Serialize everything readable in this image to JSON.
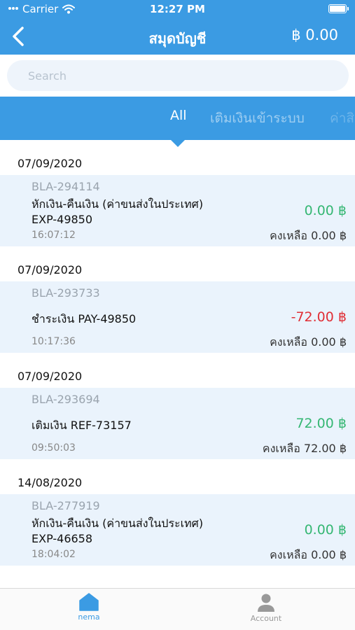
{
  "status_bar": {
    "carrier": "Carrier",
    "time": "12:27 PM"
  },
  "nav": {
    "title": "สมุดบัญชี",
    "balance": "฿ 0.00"
  },
  "search": {
    "placeholder": "Search"
  },
  "tabs": [
    {
      "label": "All"
    },
    {
      "label": "เติมเงินเข้าระบบ"
    },
    {
      "label": "ค่าสิ"
    }
  ],
  "entries": [
    {
      "date": "07/09/2020",
      "code": "BLA-294114",
      "desc_line1": "หักเงิน-คืนเงิน (ค่าขนส่งในประเทศ)",
      "desc_line2": "EXP-49850",
      "time": "16:07:12",
      "amount": "0.00 ฿",
      "remaining": "คงเหลือ 0.00 ฿"
    },
    {
      "date": "07/09/2020",
      "code": "BLA-293733",
      "desc_line1": "ชำระเงิน PAY-49850",
      "time": "10:17:36",
      "amount": "-72.00 ฿",
      "remaining": "คงเหลือ 0.00 ฿"
    },
    {
      "date": "07/09/2020",
      "code": "BLA-293694",
      "desc_line1": "เติมเงิน REF-73157",
      "time": "09:50:03",
      "amount": "72.00 ฿",
      "remaining": "คงเหลือ 72.00 ฿"
    },
    {
      "date": "14/08/2020",
      "code": "BLA-277919",
      "desc_line1": "หักเงิน-คืนเงิน (ค่าขนส่งในประเทศ)",
      "desc_line2": "EXP-46658",
      "time": "18:04:02",
      "amount": "0.00 ฿",
      "remaining": "คงเหลือ 0.00 ฿"
    }
  ],
  "tabbar": {
    "home_label": "nema",
    "account_label": "Account"
  },
  "colors": {
    "primary": "#3b9be3",
    "positive": "#35b773",
    "negative": "#e02f36",
    "entry_bg": "#eaf3fc"
  },
  "icons": {
    "back": "chevron-left-icon",
    "wifi": "wifi-icon",
    "battery": "battery-icon",
    "home": "home-icon",
    "account": "person-icon"
  }
}
